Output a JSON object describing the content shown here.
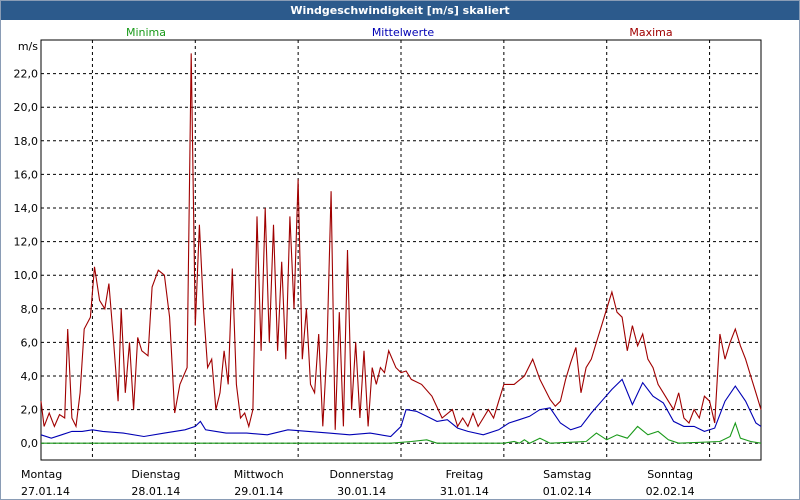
{
  "window": {
    "title": "Windgeschwindigkeit [m/s] skaliert"
  },
  "colors": {
    "titlebar": "#2c5a8c",
    "minima": "#1a9a1a",
    "mittel": "#0000b4",
    "maxima": "#a00000"
  },
  "chart_data": {
    "type": "line",
    "title": "Windgeschwindigkeit [m/s] skaliert",
    "ylabel": "m/s",
    "ylim": [
      -1,
      24
    ],
    "yticks": [
      "0,0",
      "2,0",
      "4,0",
      "6,0",
      "8,0",
      "10,0",
      "12,0",
      "14,0",
      "16,0",
      "18,0",
      "20,0",
      "22,0"
    ],
    "days": [
      {
        "name": "Montag",
        "date": "27.01.14"
      },
      {
        "name": "Dienstag",
        "date": "28.01.14"
      },
      {
        "name": "Mittwoch",
        "date": "29.01.14"
      },
      {
        "name": "Donnerstag",
        "date": "30.01.14"
      },
      {
        "name": "Freitag",
        "date": "31.01.14"
      },
      {
        "name": "Samstag",
        "date": "01.02.14"
      },
      {
        "name": "Sonntag",
        "date": "02.02.14"
      }
    ],
    "xlim": [
      0,
      7
    ],
    "grid": true,
    "legend": "top",
    "series": [
      {
        "name": "Minima",
        "color": "#1a9a1a",
        "points": [
          [
            0,
            0
          ],
          [
            3.4,
            0
          ],
          [
            3.6,
            0.1
          ],
          [
            3.75,
            0.2
          ],
          [
            3.85,
            0
          ],
          [
            4.5,
            0
          ],
          [
            4.6,
            0.1
          ],
          [
            4.65,
            0
          ],
          [
            4.7,
            0.2
          ],
          [
            4.75,
            0
          ],
          [
            4.85,
            0.3
          ],
          [
            4.95,
            0
          ],
          [
            5.3,
            0.1
          ],
          [
            5.4,
            0.6
          ],
          [
            5.5,
            0.2
          ],
          [
            5.6,
            0.5
          ],
          [
            5.7,
            0.3
          ],
          [
            5.8,
            1.0
          ],
          [
            5.9,
            0.5
          ],
          [
            6.0,
            0.7
          ],
          [
            6.1,
            0.2
          ],
          [
            6.2,
            0
          ],
          [
            6.6,
            0.1
          ],
          [
            6.7,
            0.4
          ],
          [
            6.75,
            1.2
          ],
          [
            6.8,
            0.3
          ],
          [
            6.9,
            0.1
          ],
          [
            7,
            0
          ]
        ]
      },
      {
        "name": "Mittelwerte",
        "color": "#0000b4",
        "points": [
          [
            0,
            0.5
          ],
          [
            0.1,
            0.3
          ],
          [
            0.2,
            0.5
          ],
          [
            0.3,
            0.7
          ],
          [
            0.4,
            0.7
          ],
          [
            0.5,
            0.8
          ],
          [
            0.6,
            0.7
          ],
          [
            0.8,
            0.6
          ],
          [
            1.0,
            0.4
          ],
          [
            1.2,
            0.6
          ],
          [
            1.4,
            0.8
          ],
          [
            1.5,
            1.0
          ],
          [
            1.55,
            1.3
          ],
          [
            1.6,
            0.8
          ],
          [
            1.7,
            0.7
          ],
          [
            1.8,
            0.6
          ],
          [
            2.0,
            0.6
          ],
          [
            2.2,
            0.5
          ],
          [
            2.4,
            0.8
          ],
          [
            2.6,
            0.7
          ],
          [
            2.8,
            0.6
          ],
          [
            3.0,
            0.5
          ],
          [
            3.2,
            0.6
          ],
          [
            3.4,
            0.4
          ],
          [
            3.5,
            1.0
          ],
          [
            3.55,
            2.0
          ],
          [
            3.65,
            1.9
          ],
          [
            3.75,
            1.6
          ],
          [
            3.85,
            1.3
          ],
          [
            3.95,
            1.4
          ],
          [
            4.05,
            0.9
          ],
          [
            4.15,
            0.7
          ],
          [
            4.3,
            0.5
          ],
          [
            4.45,
            0.8
          ],
          [
            4.55,
            1.2
          ],
          [
            4.65,
            1.4
          ],
          [
            4.75,
            1.6
          ],
          [
            4.85,
            2.0
          ],
          [
            4.95,
            2.1
          ],
          [
            5.05,
            1.2
          ],
          [
            5.15,
            0.8
          ],
          [
            5.25,
            1.0
          ],
          [
            5.35,
            1.8
          ],
          [
            5.45,
            2.5
          ],
          [
            5.55,
            3.2
          ],
          [
            5.65,
            3.8
          ],
          [
            5.75,
            2.3
          ],
          [
            5.85,
            3.6
          ],
          [
            5.95,
            2.8
          ],
          [
            6.05,
            2.4
          ],
          [
            6.15,
            1.3
          ],
          [
            6.25,
            1.0
          ],
          [
            6.35,
            1.0
          ],
          [
            6.45,
            0.7
          ],
          [
            6.55,
            0.9
          ],
          [
            6.65,
            2.5
          ],
          [
            6.75,
            3.4
          ],
          [
            6.85,
            2.5
          ],
          [
            6.95,
            1.2
          ],
          [
            7,
            1.0
          ]
        ]
      },
      {
        "name": "Maxima",
        "color": "#a00000",
        "points": [
          [
            0,
            2.5
          ],
          [
            0.03,
            1.0
          ],
          [
            0.08,
            1.8
          ],
          [
            0.13,
            1.0
          ],
          [
            0.18,
            1.7
          ],
          [
            0.23,
            1.5
          ],
          [
            0.26,
            6.8
          ],
          [
            0.3,
            1.5
          ],
          [
            0.34,
            1.0
          ],
          [
            0.38,
            3.0
          ],
          [
            0.42,
            6.8
          ],
          [
            0.48,
            7.5
          ],
          [
            0.52,
            10.5
          ],
          [
            0.57,
            8.5
          ],
          [
            0.62,
            8.0
          ],
          [
            0.66,
            9.5
          ],
          [
            0.7,
            6.5
          ],
          [
            0.75,
            2.5
          ],
          [
            0.78,
            8.0
          ],
          [
            0.82,
            3.0
          ],
          [
            0.86,
            6.0
          ],
          [
            0.9,
            2.0
          ],
          [
            0.94,
            6.3
          ],
          [
            0.98,
            5.5
          ],
          [
            1.04,
            5.2
          ],
          [
            1.08,
            9.3
          ],
          [
            1.14,
            10.3
          ],
          [
            1.2,
            10.0
          ],
          [
            1.25,
            7.5
          ],
          [
            1.3,
            1.8
          ],
          [
            1.35,
            3.5
          ],
          [
            1.42,
            4.5
          ],
          [
            1.46,
            23.2
          ],
          [
            1.5,
            7.0
          ],
          [
            1.54,
            13.0
          ],
          [
            1.58,
            8.0
          ],
          [
            1.62,
            4.5
          ],
          [
            1.66,
            5.0
          ],
          [
            1.7,
            2.0
          ],
          [
            1.74,
            3.0
          ],
          [
            1.78,
            5.5
          ],
          [
            1.82,
            3.5
          ],
          [
            1.86,
            10.4
          ],
          [
            1.9,
            3.5
          ],
          [
            1.94,
            1.5
          ],
          [
            1.98,
            1.8
          ],
          [
            2.02,
            1.0
          ],
          [
            2.06,
            2.0
          ],
          [
            2.1,
            13.5
          ],
          [
            2.14,
            5.5
          ],
          [
            2.18,
            14.0
          ],
          [
            2.22,
            6.0
          ],
          [
            2.26,
            13.0
          ],
          [
            2.3,
            5.5
          ],
          [
            2.34,
            10.8
          ],
          [
            2.38,
            5.0
          ],
          [
            2.42,
            13.5
          ],
          [
            2.46,
            8.0
          ],
          [
            2.5,
            15.7
          ],
          [
            2.54,
            5.0
          ],
          [
            2.58,
            8.0
          ],
          [
            2.62,
            3.5
          ],
          [
            2.66,
            3.0
          ],
          [
            2.7,
            6.5
          ],
          [
            2.74,
            1.0
          ],
          [
            2.78,
            5.5
          ],
          [
            2.82,
            15.0
          ],
          [
            2.86,
            0.8
          ],
          [
            2.9,
            7.8
          ],
          [
            2.94,
            1.0
          ],
          [
            2.98,
            11.5
          ],
          [
            3.02,
            2.0
          ],
          [
            3.06,
            6.0
          ],
          [
            3.1,
            1.5
          ],
          [
            3.14,
            5.5
          ],
          [
            3.18,
            1.0
          ],
          [
            3.22,
            4.5
          ],
          [
            3.26,
            3.5
          ],
          [
            3.3,
            4.5
          ],
          [
            3.34,
            4.2
          ],
          [
            3.38,
            5.5
          ],
          [
            3.45,
            4.5
          ],
          [
            3.5,
            4.2
          ],
          [
            3.55,
            4.3
          ],
          [
            3.6,
            3.8
          ],
          [
            3.7,
            3.5
          ],
          [
            3.8,
            2.8
          ],
          [
            3.9,
            1.5
          ],
          [
            4.0,
            2.0
          ],
          [
            4.05,
            1.0
          ],
          [
            4.1,
            1.5
          ],
          [
            4.15,
            1.0
          ],
          [
            4.2,
            1.8
          ],
          [
            4.25,
            1.0
          ],
          [
            4.3,
            1.5
          ],
          [
            4.35,
            2.0
          ],
          [
            4.4,
            1.5
          ],
          [
            4.45,
            2.5
          ],
          [
            4.5,
            3.5
          ],
          [
            4.6,
            3.5
          ],
          [
            4.7,
            4.0
          ],
          [
            4.78,
            5.0
          ],
          [
            4.85,
            3.8
          ],
          [
            4.95,
            2.6
          ],
          [
            5.0,
            2.2
          ],
          [
            5.05,
            2.5
          ],
          [
            5.1,
            3.8
          ],
          [
            5.15,
            4.8
          ],
          [
            5.2,
            5.7
          ],
          [
            5.25,
            3.0
          ],
          [
            5.3,
            4.5
          ],
          [
            5.35,
            5.0
          ],
          [
            5.4,
            6.0
          ],
          [
            5.45,
            7.0
          ],
          [
            5.5,
            8.0
          ],
          [
            5.55,
            9.0
          ],
          [
            5.6,
            7.8
          ],
          [
            5.65,
            7.5
          ],
          [
            5.7,
            5.5
          ],
          [
            5.75,
            7.0
          ],
          [
            5.8,
            5.8
          ],
          [
            5.85,
            6.5
          ],
          [
            5.9,
            5.0
          ],
          [
            5.95,
            4.5
          ],
          [
            6.0,
            3.5
          ],
          [
            6.05,
            3.0
          ],
          [
            6.1,
            2.5
          ],
          [
            6.15,
            2.0
          ],
          [
            6.2,
            3.0
          ],
          [
            6.25,
            1.5
          ],
          [
            6.3,
            1.2
          ],
          [
            6.35,
            2.0
          ],
          [
            6.4,
            1.5
          ],
          [
            6.45,
            2.8
          ],
          [
            6.5,
            2.5
          ],
          [
            6.55,
            1.2
          ],
          [
            6.6,
            6.5
          ],
          [
            6.65,
            5.0
          ],
          [
            6.7,
            6.0
          ],
          [
            6.75,
            6.8
          ],
          [
            6.8,
            5.8
          ],
          [
            6.85,
            5.0
          ],
          [
            6.9,
            4.0
          ],
          [
            6.95,
            3.0
          ],
          [
            7.0,
            2.0
          ]
        ]
      }
    ]
  }
}
